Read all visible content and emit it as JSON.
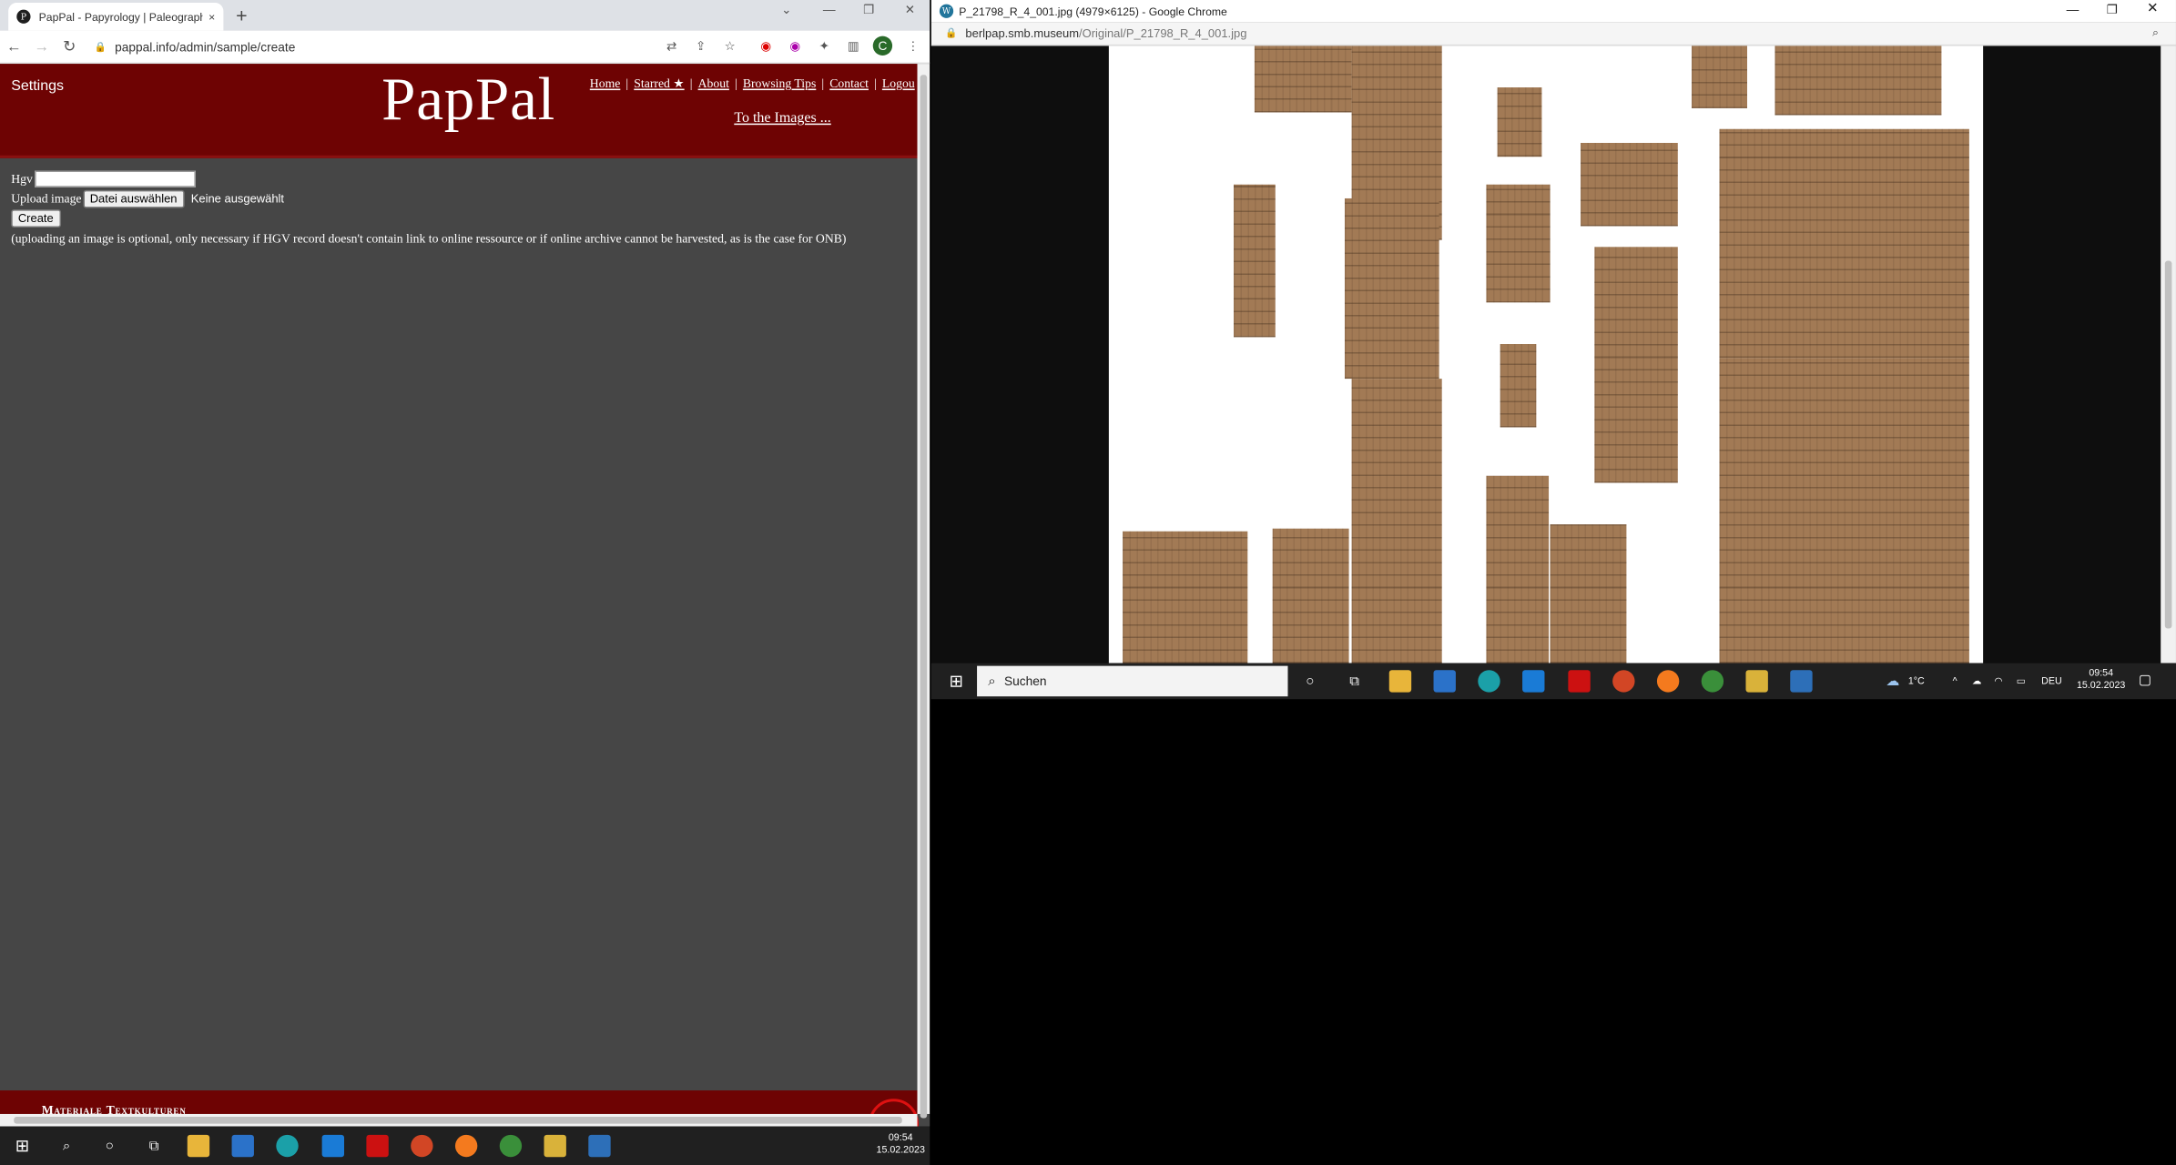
{
  "left_browser": {
    "tab_title": "PapPal - Papyrology | Paleograph",
    "tab_close": "×",
    "new_tab": "+",
    "url": "pappal.info/admin/sample/create",
    "site": {
      "settings_label": "Settings",
      "logo": "PapPal",
      "nav": [
        "Home",
        "Starred ★",
        "About",
        "Browsing Tips",
        "Contact",
        "Logou"
      ],
      "nav_sep": "|",
      "to_images": "To the Images ..."
    },
    "form": {
      "hgv_label": "Hgv",
      "hgv_value": "",
      "upload_label": "Upload image",
      "file_button": "Datei auswählen",
      "no_file": "Keine ausgewählt",
      "create_button": "Create",
      "note": "(uploading an image is optional, only necessary if HGV record doesn't contain link to online ressource or if online archive cannot be harvested, as is the case for ONB)"
    },
    "footer_text": "Materiale Textkulturen"
  },
  "right_browser": {
    "window_title": "P_21798_R_4_001.jpg (4979×6125) - Google Chrome",
    "url_host": "berlpap.smb.museum",
    "url_path": "/Original/P_21798_R_4_001.jpg"
  },
  "taskbar_right": {
    "search_placeholder": "Suchen",
    "weather": "1°C",
    "language": "DEU",
    "time": "09:54",
    "date": "15.02.2023"
  },
  "taskbar_left": {
    "time": "09:54",
    "date": "15.02.2023"
  },
  "colors": {
    "site_header": "#6e0303",
    "page_bg": "#464646",
    "papyrus": "#a27a55"
  }
}
